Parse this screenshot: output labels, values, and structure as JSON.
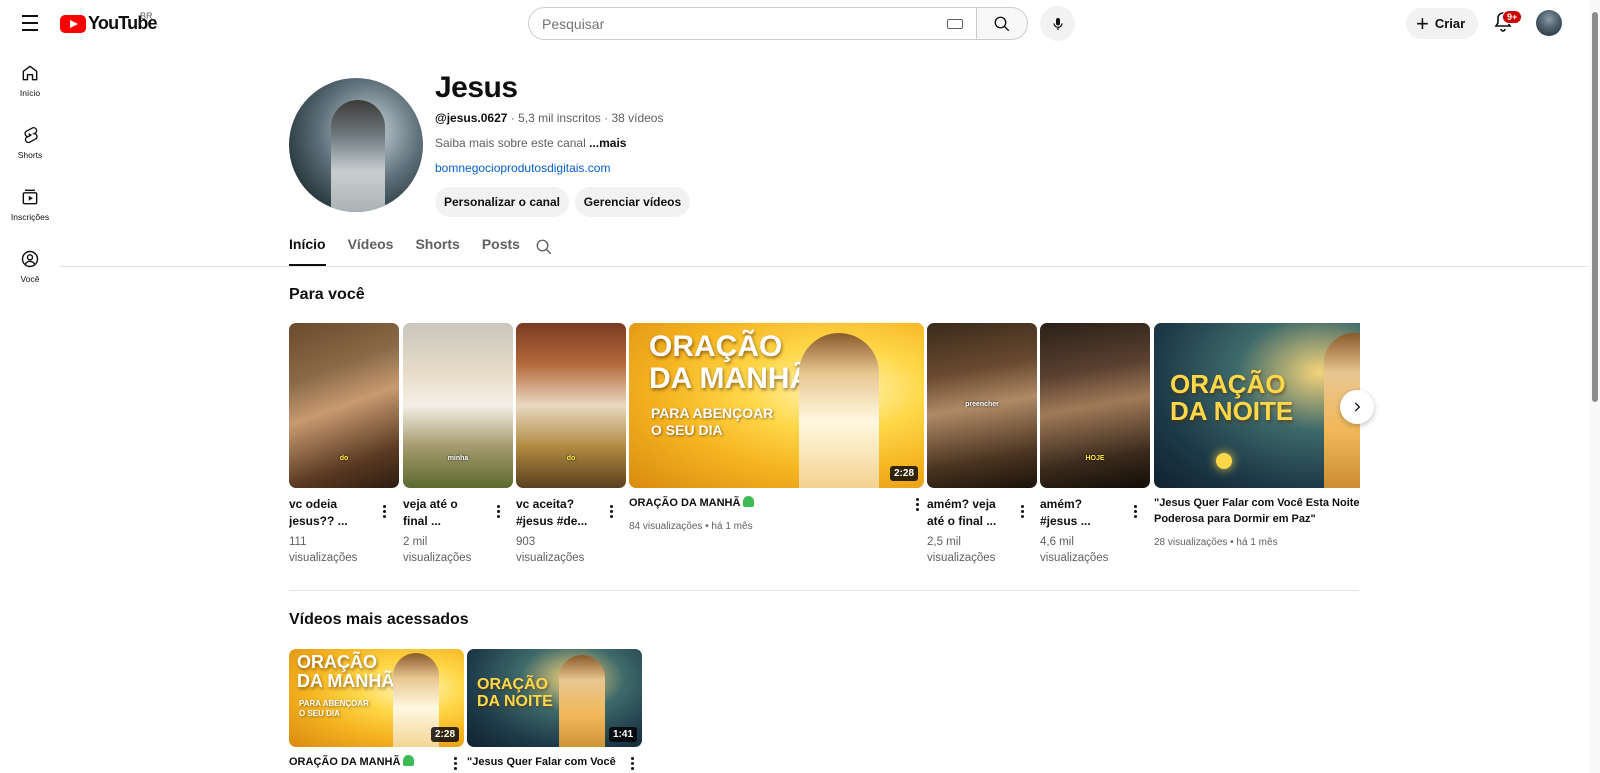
{
  "header": {
    "logo_text": "YouTube",
    "country_code": "BR",
    "search_placeholder": "Pesquisar",
    "create_label": "Criar",
    "notifications_badge": "9+"
  },
  "sidebar": {
    "items": [
      {
        "label": "Início",
        "icon": "home-icon"
      },
      {
        "label": "Shorts",
        "icon": "shorts-icon"
      },
      {
        "label": "Inscrições",
        "icon": "subscriptions-icon"
      },
      {
        "label": "Você",
        "icon": "you-icon"
      }
    ]
  },
  "channel": {
    "name": "Jesus",
    "handle": "@jesus.0627",
    "meta_rest": " · 5,3 mil inscritos · 38 vídeos",
    "description": "Saiba mais sobre este canal ",
    "more_label": "...mais",
    "link": "bomnegocioprodutosdigitais.com",
    "customize_label": "Personalizar o canal",
    "manage_label": "Gerenciar vídeos"
  },
  "tabs": [
    "Início",
    "Vídeos",
    "Shorts",
    "Posts"
  ],
  "for_you": {
    "title": "Para você",
    "shorts_left": [
      {
        "title_line1": "vc odeia",
        "title_line2": "jesus?? ...",
        "views1": "111",
        "views2": "visualizações",
        "caption": "do"
      },
      {
        "title_line1": "veja até o",
        "title_line2": "final ...",
        "views1": "2 mil",
        "views2": "visualizações",
        "caption": "minha"
      },
      {
        "title_line1": "vc aceita?",
        "title_line2": "#jesus #de...",
        "views1": "903",
        "views2": "visualizações",
        "caption": "do"
      }
    ],
    "wide_video": {
      "title": "ORAÇÃO DA MANHÃ",
      "meta": "84 visualizações • há 1 mês",
      "duration": "2:28",
      "overlay_line1": "ORAÇÃO",
      "overlay_line2": "DA MANHÃ",
      "overlay_sub1": "PARA ABENÇOAR",
      "overlay_sub2": "O SEU DIA"
    },
    "shorts_right": [
      {
        "title_line1": "amém? veja",
        "title_line2": "até o final ...",
        "views1": "2,5 mil",
        "views2": "visualizações",
        "caption": "preencher"
      },
      {
        "title_line1": "amém?",
        "title_line2": "#jesus ...",
        "views1": "4,6 mil",
        "views2": "visualizações",
        "caption": "HOJE"
      }
    ],
    "night_video": {
      "title_line1": "\"Jesus Quer Falar com Você Esta Noite",
      "title_line2": "Poderosa para Dormir em Paz\"",
      "meta": "28 visualizações • há 1 mês",
      "overlay_line1": "ORAÇÃO",
      "overlay_line2": "DA NOITE"
    }
  },
  "most_viewed": {
    "title": "Vídeos mais acessados",
    "videos": [
      {
        "title": "ORAÇÃO DA MANHÃ",
        "duration": "2:28",
        "overlay_line1": "ORAÇÃO",
        "overlay_line2": "DA MANHÃ",
        "overlay_sub1": "PARA ABENÇOAR",
        "overlay_sub2": "O SEU DIA"
      },
      {
        "title": "\"Jesus Quer Falar com Você",
        "duration": "1:41",
        "overlay_line1": "ORAÇÃO",
        "overlay_line2": "DA NOITE"
      }
    ]
  },
  "colors": {
    "brand_red": "#ff0000",
    "link_blue": "#065fd4",
    "badge_red": "#cc0000"
  }
}
